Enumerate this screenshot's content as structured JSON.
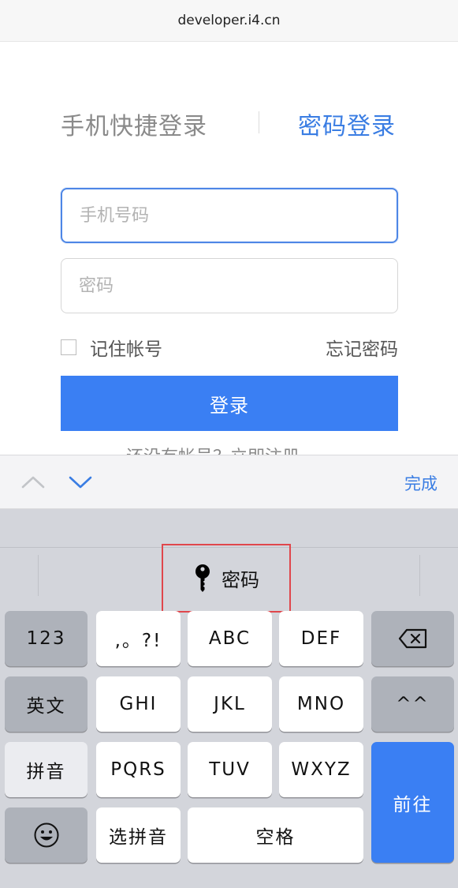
{
  "browser": {
    "url": "developer.i4.cn"
  },
  "login": {
    "tab_phone": "手机快捷登录",
    "tab_password": "密码登录",
    "phone_placeholder": "手机号码",
    "password_placeholder": "密码",
    "remember_label": "记住帐号",
    "forgot_label": "忘记密码",
    "submit_label": "登录",
    "partially_hidden_text": "还没有帐号？立即注册"
  },
  "accessory": {
    "done_label": "完成"
  },
  "keyboard": {
    "suggestion_label": "密码",
    "keys": {
      "num": "123",
      "punct": ",。?!",
      "abc": "ABC",
      "def": "DEF",
      "english": "英文",
      "ghi": "GHI",
      "jkl": "JKL",
      "mno": "MNO",
      "emoticon": "^^",
      "pinyin": "拼音",
      "pqrs": "PQRS",
      "tuv": "TUV",
      "wxyz": "WXYZ",
      "go": "前往",
      "select_pinyin": "选拼音",
      "space": "空格"
    }
  },
  "colors": {
    "accent": "#3a7ff3",
    "highlight_border": "#e0474c"
  }
}
